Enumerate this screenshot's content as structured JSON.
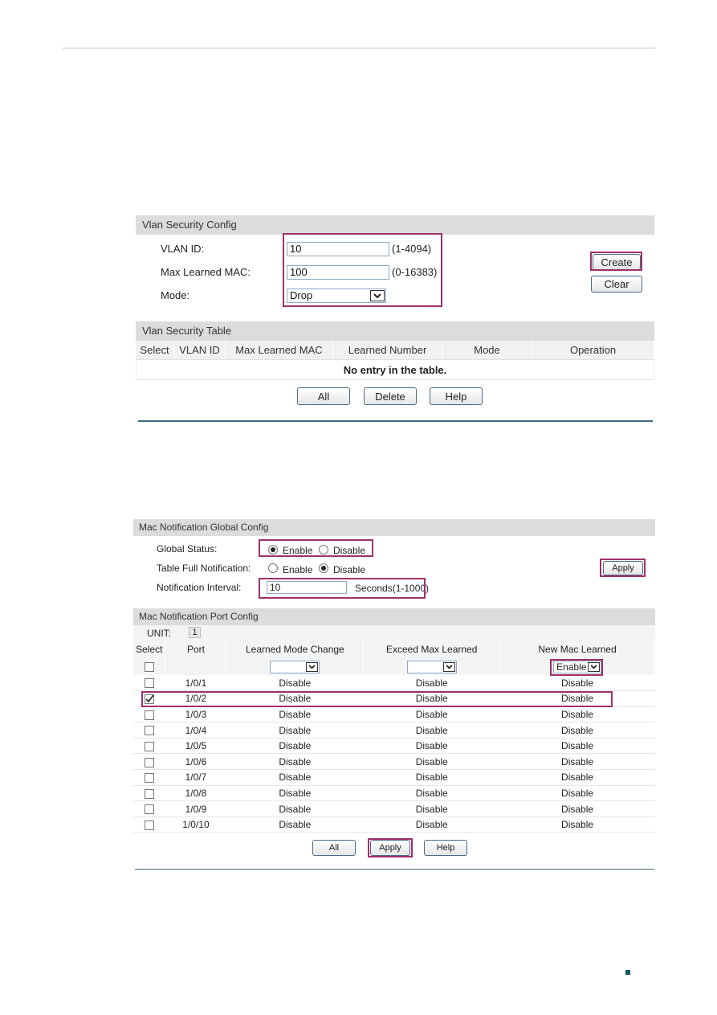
{
  "vlan_security_config": {
    "title": "Vlan Security Config",
    "vlan_id_label": "VLAN ID:",
    "vlan_id_value": "10",
    "vlan_id_range": "(1-4094)",
    "max_mac_label": "Max Learned MAC:",
    "max_mac_value": "100",
    "max_mac_range": "(0-16383)",
    "mode_label": "Mode:",
    "mode_value": "Drop",
    "create_label": "Create",
    "clear_label": "Clear"
  },
  "vlan_security_table": {
    "title": "Vlan Security Table",
    "columns": [
      "Select",
      "VLAN ID",
      "Max Learned MAC",
      "Learned Number",
      "Mode",
      "Operation"
    ],
    "empty_message": "No entry in the table.",
    "buttons": {
      "all": "All",
      "delete": "Delete",
      "help": "Help"
    }
  },
  "mac_notification_global": {
    "title": "Mac Notification Global Config",
    "global_status_label": "Global Status:",
    "table_full_label": "Table Full Notification:",
    "interval_label": "Notification Interval:",
    "enable_label": "Enable",
    "disable_label": "Disable",
    "global_status": "Enable",
    "table_full": "Disable",
    "interval_value": "10",
    "interval_hint": "Seconds(1-1000)",
    "apply_label": "Apply"
  },
  "mac_notification_port": {
    "title": "Mac Notification Port Config",
    "unit_label": "UNIT:",
    "unit_value": "1",
    "columns": [
      "Select",
      "Port",
      "Learned Mode Change",
      "Exceed Max Learned",
      "New Mac Learned"
    ],
    "bulk": {
      "learned_mode_change": "",
      "exceed_max_learned": "",
      "new_mac_learned": "Enable"
    },
    "rows": [
      {
        "port": "1/0/1",
        "lmc": "Disable",
        "eml": "Disable",
        "nml": "Disable",
        "selected": false
      },
      {
        "port": "1/0/2",
        "lmc": "Disable",
        "eml": "Disable",
        "nml": "Disable",
        "selected": true
      },
      {
        "port": "1/0/3",
        "lmc": "Disable",
        "eml": "Disable",
        "nml": "Disable",
        "selected": false
      },
      {
        "port": "1/0/4",
        "lmc": "Disable",
        "eml": "Disable",
        "nml": "Disable",
        "selected": false
      },
      {
        "port": "1/0/5",
        "lmc": "Disable",
        "eml": "Disable",
        "nml": "Disable",
        "selected": false
      },
      {
        "port": "1/0/6",
        "lmc": "Disable",
        "eml": "Disable",
        "nml": "Disable",
        "selected": false
      },
      {
        "port": "1/0/7",
        "lmc": "Disable",
        "eml": "Disable",
        "nml": "Disable",
        "selected": false
      },
      {
        "port": "1/0/8",
        "lmc": "Disable",
        "eml": "Disable",
        "nml": "Disable",
        "selected": false
      },
      {
        "port": "1/0/9",
        "lmc": "Disable",
        "eml": "Disable",
        "nml": "Disable",
        "selected": false
      },
      {
        "port": "1/0/10",
        "lmc": "Disable",
        "eml": "Disable",
        "nml": "Disable",
        "selected": false
      }
    ],
    "buttons": {
      "all": "All",
      "apply": "Apply",
      "help": "Help"
    }
  },
  "colors": {
    "highlight": "#a0306a",
    "rule": "#3a6b7b",
    "page_mark": "#0e5660"
  }
}
